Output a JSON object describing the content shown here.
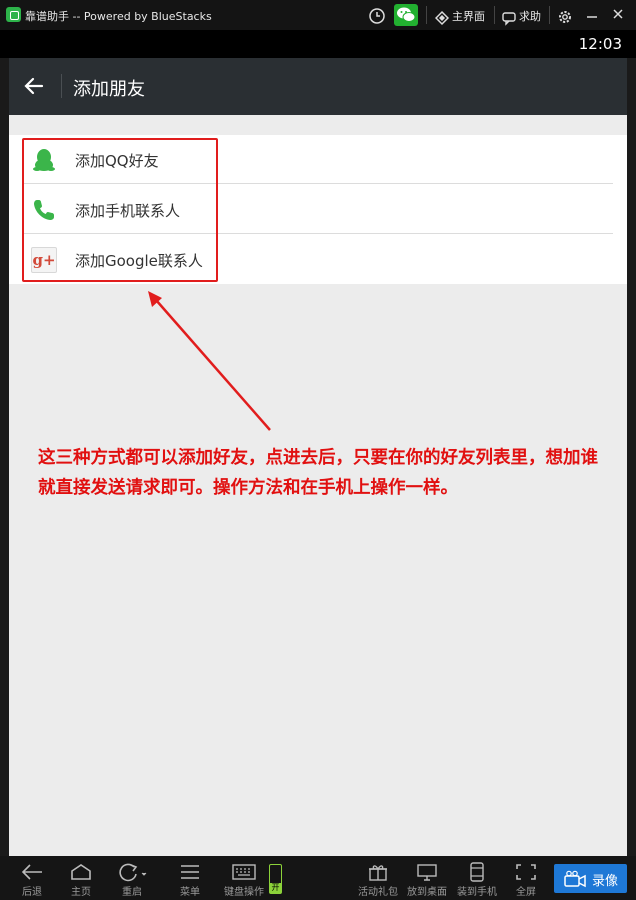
{
  "window": {
    "title": "靠谱助手  -- Powered by BlueStacks",
    "home_label": "主界面",
    "help_label": "求助"
  },
  "status": {
    "time": "12:03"
  },
  "appbar": {
    "title": "添加朋友"
  },
  "list": {
    "items": [
      {
        "label": "添加QQ好友",
        "icon": "qq-penguin-icon",
        "icon_color": "#3bb54a"
      },
      {
        "label": "添加手机联系人",
        "icon": "phone-icon",
        "icon_color": "#3bb54a"
      },
      {
        "label": "添加Google联系人",
        "icon": "google-plus-icon",
        "icon_glyph": "g+",
        "icon_color": "#d24a3a"
      }
    ]
  },
  "annotation": {
    "text": "这三种方式都可以添加好友，点进去后，只要在你的好友列表里，想加谁就直接发送请求即可。操作方法和在手机上操作一样。",
    "color": "#e11010"
  },
  "bottombar": {
    "items": [
      {
        "label": "后退"
      },
      {
        "label": "主页"
      },
      {
        "label": "重启"
      },
      {
        "label": "菜单"
      },
      {
        "label": "键盘操作"
      },
      {
        "label": "活动礼包"
      },
      {
        "label": "放到桌面"
      },
      {
        "label": "装到手机"
      },
      {
        "label": "全屏"
      }
    ],
    "keyboard_toggle": "开",
    "record_label": "录像"
  },
  "colors": {
    "accent_green": "#3bb54a",
    "highlight_red": "#e11d1d",
    "record_blue": "#1e78d6",
    "appbar": "#2a2f33"
  }
}
